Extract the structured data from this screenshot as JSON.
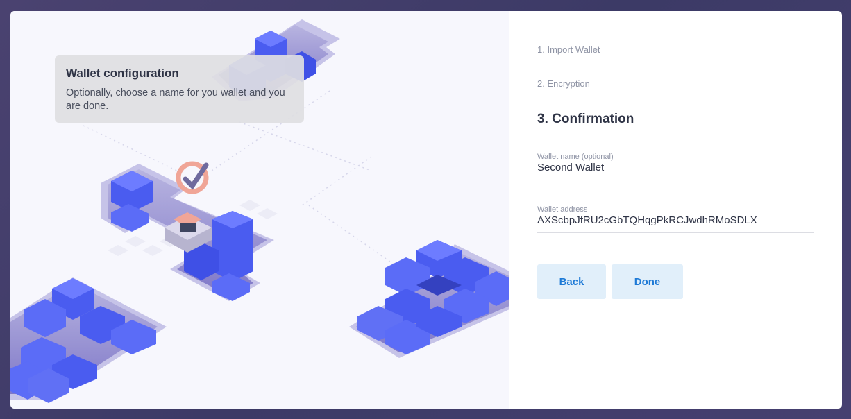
{
  "tooltip": {
    "title": "Wallet configuration",
    "body": "Optionally, choose a name for you wallet and you are done."
  },
  "steps": [
    {
      "label": "1. Import Wallet"
    },
    {
      "label": "2. Encryption"
    },
    {
      "label": "3. Confirmation"
    }
  ],
  "fields": {
    "wallet_name": {
      "label": "Wallet name (optional)",
      "value": "Second Wallet"
    },
    "wallet_address": {
      "label": "Wallet address",
      "value": "AXScbpJfRU2cGbTQHqgPkRCJwdhRMoSDLX"
    }
  },
  "buttons": {
    "back": "Back",
    "done": "Done"
  },
  "colors": {
    "accent": "#1e7ad6",
    "button_bg": "#e1effa",
    "block_blue": "#4a5cf0"
  }
}
